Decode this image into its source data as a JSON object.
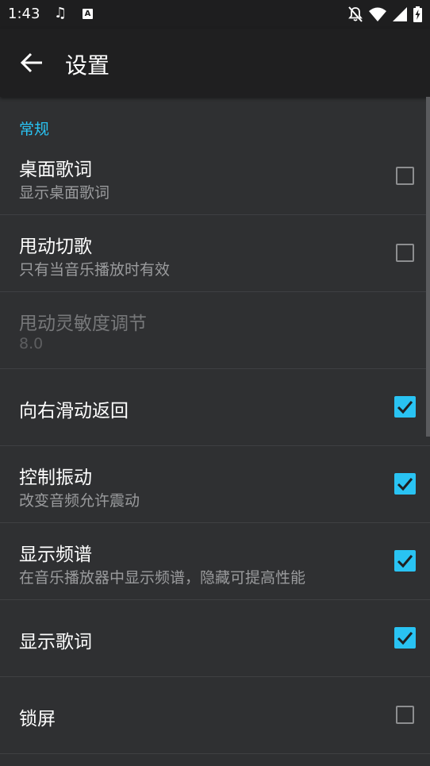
{
  "status_bar": {
    "time": "1:43",
    "icons": [
      "music-note-icon",
      "app-a-icon",
      "bell-off-icon",
      "wifi-icon",
      "signal-icon",
      "battery-charging-icon"
    ]
  },
  "app_bar": {
    "title": "设置",
    "back_icon": "arrow-back-icon"
  },
  "section": {
    "header": "常规"
  },
  "accent_color": "#29c3f3",
  "items": [
    {
      "title": "桌面歌词",
      "summary": "显示桌面歌词",
      "checked": false,
      "enabled": true
    },
    {
      "title": "甩动切歌",
      "summary": "只有当音乐播放时有效",
      "checked": false,
      "enabled": true
    },
    {
      "title": "甩动灵敏度调节",
      "summary": "8.0",
      "enabled": false
    },
    {
      "title": "向右滑动返回",
      "summary": "",
      "checked": true,
      "enabled": true
    },
    {
      "title": "控制振动",
      "summary": "改变音频允许震动",
      "checked": true,
      "enabled": true
    },
    {
      "title": "显示频谱",
      "summary": "在音乐播放器中显示频谱，隐藏可提高性能",
      "checked": true,
      "enabled": true
    },
    {
      "title": "显示歌词",
      "summary": "",
      "checked": true,
      "enabled": true
    },
    {
      "title": "锁屏",
      "summary": "",
      "checked": false,
      "enabled": true
    }
  ]
}
